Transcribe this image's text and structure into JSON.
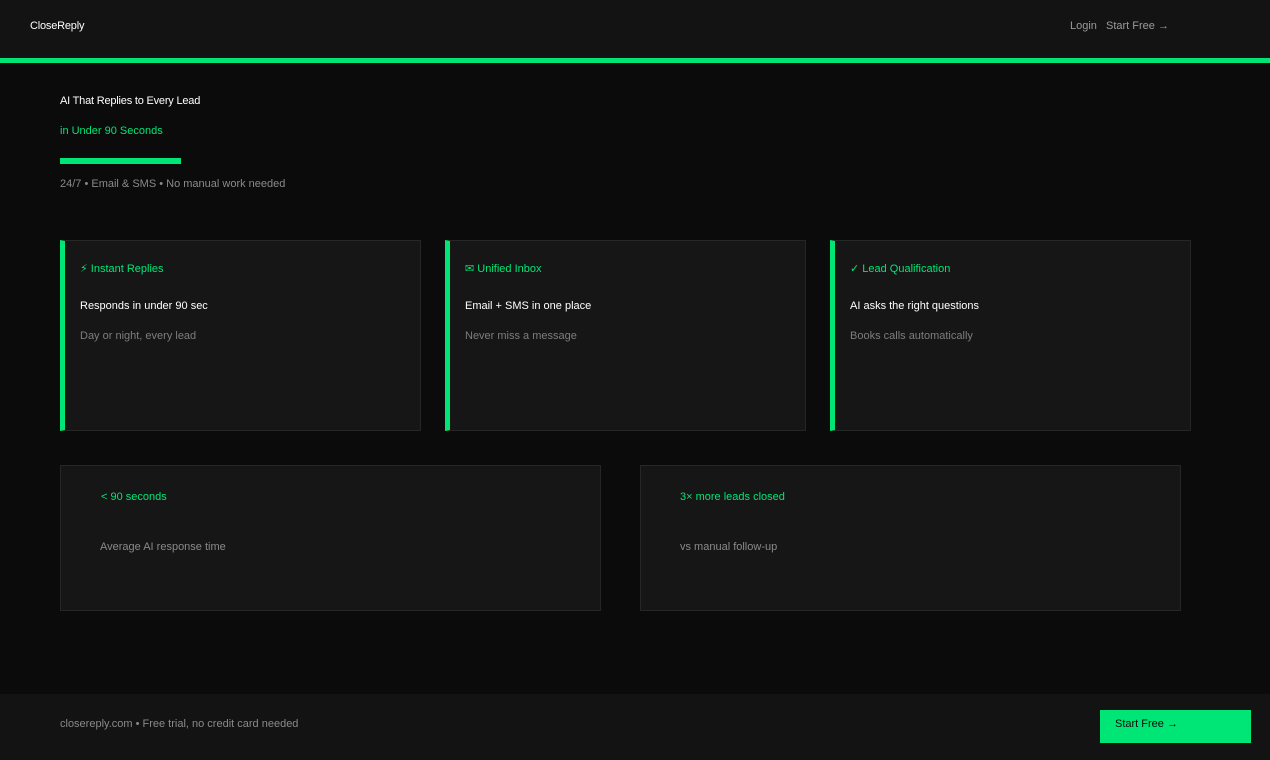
{
  "header": {
    "brand": "CloseReply",
    "nav": {
      "login": "Login",
      "start_free": "Start Free →"
    }
  },
  "hero": {
    "title": "AI That Replies to Every Lead",
    "subtitle": "in Under 90 Seconds",
    "note": "24/7 • Email & SMS • No manual work needed"
  },
  "features": [
    {
      "title": "⚡ Instant Replies",
      "heading": "Responds in under 90 sec",
      "description": "Day or night, every lead"
    },
    {
      "title": "✉ Unified Inbox",
      "heading": "Email + SMS in one place",
      "description": "Never miss a message"
    },
    {
      "title": "✓ Lead Qualification",
      "heading": "AI asks the right questions",
      "description": "Books calls automatically"
    }
  ],
  "stats": [
    {
      "value": "< 90 seconds",
      "label": "Average AI response time"
    },
    {
      "value": "3× more leads closed",
      "label": "vs manual follow-up"
    }
  ],
  "footer": {
    "text": "closereply.com • Free trial, no credit card needed",
    "cta": "Start Free →"
  },
  "colors": {
    "accent": "#00e676",
    "background": "#0b0b0b",
    "panel": "#161616"
  }
}
